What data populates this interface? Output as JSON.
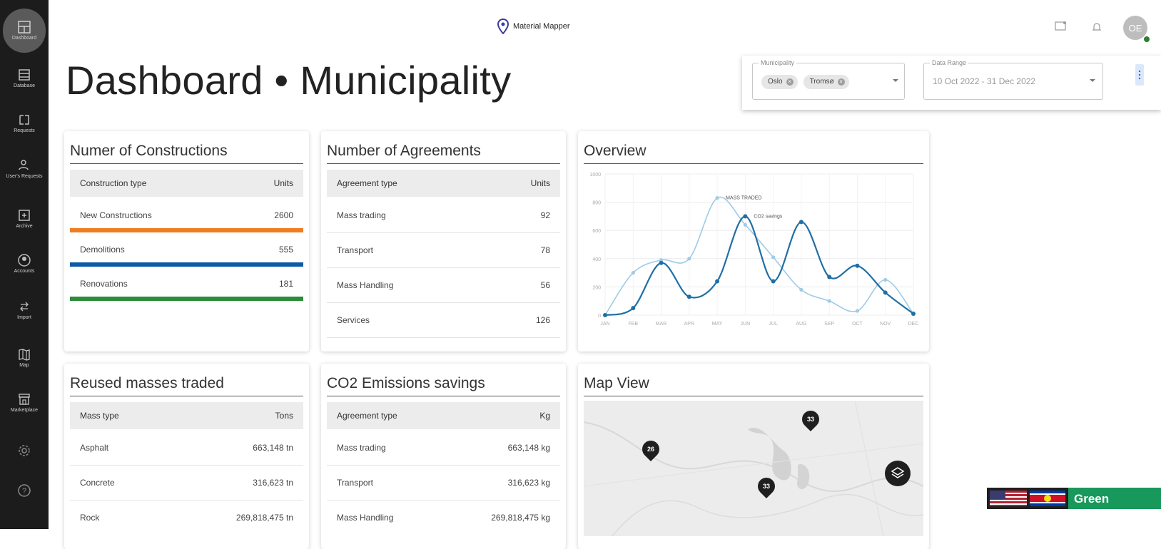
{
  "app": {
    "title": "Material Mapper"
  },
  "sidebar": {
    "items": [
      {
        "label": "Dashboard",
        "icon": "dashboard-icon",
        "active": true
      },
      {
        "label": "Database",
        "icon": "database-icon"
      },
      {
        "label": "Requests",
        "icon": "requests-icon"
      },
      {
        "label": "User's Requests",
        "icon": "user-requests-icon"
      },
      {
        "label": "Archive",
        "icon": "archive-icon"
      },
      {
        "label": "Accounts",
        "icon": "accounts-icon"
      },
      {
        "label": "Import",
        "icon": "import-icon"
      },
      {
        "label": "Map",
        "icon": "map-icon"
      },
      {
        "label": "Marketplace",
        "icon": "marketplace-icon"
      },
      {
        "label": "",
        "icon": "settings-icon"
      },
      {
        "label": "",
        "icon": "help-icon"
      }
    ]
  },
  "header": {
    "avatar_initials": "OE"
  },
  "page": {
    "title": "Dashboard • Municipality"
  },
  "filters": {
    "municipality_label": "Municipality",
    "municipalities": [
      "Oslo",
      "Tromsø"
    ],
    "date_range_label": "Data Range",
    "date_range_value": "10 Oct 2022 - 31 Dec 2022"
  },
  "constructions": {
    "title": "Numer of Constructions",
    "col1": "Construction type",
    "col2": "Units",
    "rows": [
      {
        "type": "New Constructions",
        "units": "2600",
        "color": "#ef7d22"
      },
      {
        "type": "Demolitions",
        "units": "555",
        "color": "#0d5aa7"
      },
      {
        "type": "Renovations",
        "units": "181",
        "color": "#2e8b3a"
      }
    ]
  },
  "agreements": {
    "title": "Number of Agreements",
    "col1": "Agreement type",
    "col2": "Units",
    "rows": [
      {
        "type": "Mass trading",
        "units": "92"
      },
      {
        "type": "Transport",
        "units": "78"
      },
      {
        "type": "Mass Handling",
        "units": "56"
      },
      {
        "type": "Services",
        "units": "126"
      }
    ]
  },
  "overview": {
    "title": "Overview"
  },
  "chart_data": {
    "type": "line",
    "title": "Overview",
    "categories": [
      "JAN",
      "FEB",
      "MAR",
      "APR",
      "MAY",
      "JUN",
      "JUL",
      "AUG",
      "SEP",
      "OCT",
      "NOV",
      "DEC"
    ],
    "y_ticks": [
      "0",
      "200",
      "400",
      "600",
      "800",
      "1000"
    ],
    "ylim": [
      0,
      1000
    ],
    "series": [
      {
        "name": "MASS TRADED",
        "color": "#9fcbe6",
        "values": [
          0,
          300,
          390,
          400,
          830,
          640,
          410,
          180,
          100,
          30,
          250,
          10
        ]
      },
      {
        "name": "CO2 savings",
        "color": "#1f6fa5",
        "values": [
          0,
          50,
          370,
          130,
          240,
          700,
          240,
          660,
          270,
          350,
          160,
          10
        ]
      }
    ],
    "grid": true
  },
  "reused": {
    "title": "Reused masses traded",
    "col1": "Mass type",
    "col2": "Tons",
    "rows": [
      {
        "type": "Asphalt",
        "value": "663,148 tn"
      },
      {
        "type": "Concrete",
        "value": "316,623 tn"
      },
      {
        "type": "Rock",
        "value": "269,818,475 tn"
      }
    ]
  },
  "co2": {
    "title": "CO2 Emissions savings",
    "col1": "Agreement type",
    "col2": "Kg",
    "rows": [
      {
        "type": "Mass trading",
        "value": "663,148 kg"
      },
      {
        "type": "Transport",
        "value": "316,623 kg"
      },
      {
        "type": "Mass Handling",
        "value": "269,818,475 kg"
      }
    ]
  },
  "mapview": {
    "title": "Map View",
    "pins": [
      "26",
      "33",
      "33"
    ]
  },
  "badge": {
    "text": "Green"
  }
}
